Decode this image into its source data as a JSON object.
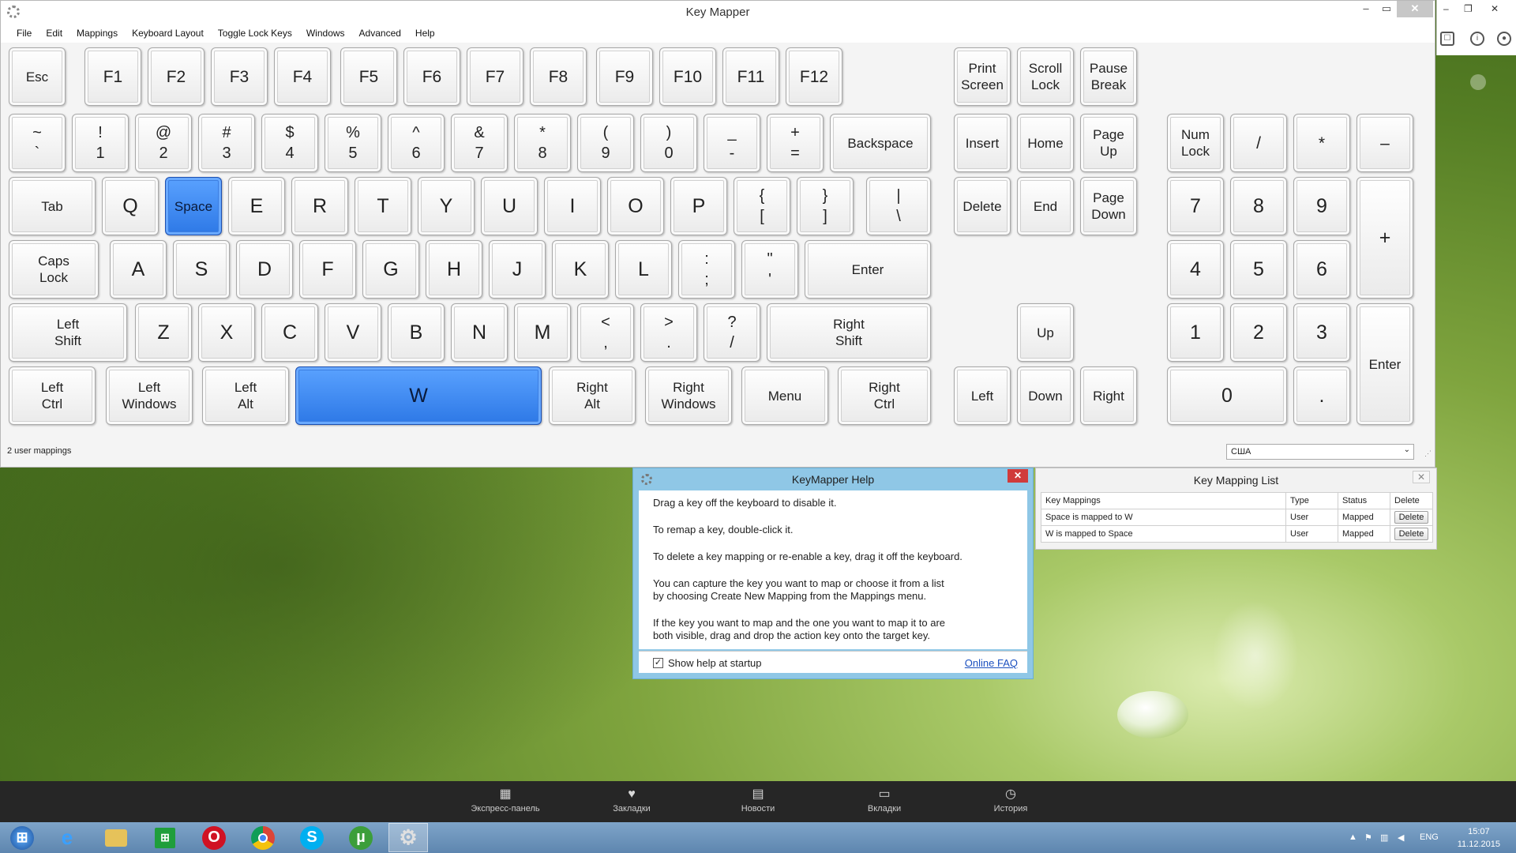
{
  "window": {
    "title": "Key Mapper"
  },
  "menu": [
    "File",
    "Edit",
    "Mappings",
    "Keyboard Layout",
    "Toggle Lock Keys",
    "Windows",
    "Advanced",
    "Help"
  ],
  "keys": {
    "esc": "Esc",
    "f1": "F1",
    "f2": "F2",
    "f3": "F3",
    "f4": "F4",
    "f5": "F5",
    "f6": "F6",
    "f7": "F7",
    "f8": "F8",
    "f9": "F9",
    "f10": "F10",
    "f11": "F11",
    "f12": "F12",
    "prtsc": "Print\nScreen",
    "scroll": "Scroll\nLock",
    "pause": "Pause\nBreak",
    "tilde": "~\n`",
    "k1": "!\n1",
    "k2": "@\n2",
    "k3": "#\n3",
    "k4": "$\n4",
    "k5": "%\n5",
    "k6": "^\n6",
    "k7": "&\n7",
    "k8": "*\n8",
    "k9": "(\n9",
    "k0": ")\n0",
    "minus": "_\n-",
    "equals": "+\n=",
    "backspace": "Backspace",
    "insert": "Insert",
    "home": "Home",
    "pgup": "Page\nUp",
    "numlock": "Num\nLock",
    "npdiv": "/",
    "npmul": "*",
    "npminus": "–",
    "tab": "Tab",
    "q": "Q",
    "w_pos": "Space",
    "e": "E",
    "r": "R",
    "t": "T",
    "y": "Y",
    "u": "U",
    "i": "I",
    "o": "O",
    "p": "P",
    "lbr": "{\n[",
    "rbr": "}\n]",
    "bslash": "|\n\\",
    "delete": "Delete",
    "end": "End",
    "pgdn": "Page\nDown",
    "np7": "7",
    "np8": "8",
    "np9": "9",
    "npplus": "+",
    "caps": "Caps\nLock",
    "a": "A",
    "s": "S",
    "d": "D",
    "f": "F",
    "g": "G",
    "h": "H",
    "j": "J",
    "k": "K",
    "l": "L",
    "semi": ":\n;",
    "quote": "\"\n'",
    "enter": "Enter",
    "np4": "4",
    "np5": "5",
    "np6": "6",
    "lshift": "Left\nShift",
    "z": "Z",
    "x": "X",
    "c": "C",
    "v": "V",
    "b": "B",
    "n": "N",
    "m": "M",
    "comma": "<\n,",
    "period": ">\n.",
    "slash": "?\n/",
    "rshift": "Right\nShift",
    "up": "Up",
    "np1": "1",
    "np2": "2",
    "np3": "3",
    "npenter": "Enter",
    "lctrl": "Left\nCtrl",
    "lwin": "Left\nWindows",
    "lalt": "Left\nAlt",
    "space_pos": "W",
    "ralt": "Right\nAlt",
    "rwin": "Right\nWindows",
    "menu": "Menu",
    "rctrl": "Right\nCtrl",
    "left": "Left",
    "down": "Down",
    "right": "Right",
    "np0": "0",
    "npdot": "."
  },
  "status": {
    "text": "2 user mappings",
    "layout": "США"
  },
  "help": {
    "title": "KeyMapper Help",
    "lines": [
      "Drag a key off the keyboard to disable it.",
      "To remap a key, double-click it.",
      "To delete a key mapping or re-enable a key, drag it off the keyboard.",
      "You can capture the key you want to map or choose it from a list\nby choosing Create New Mapping from the Mappings menu.",
      "If the key you want to map and the one you want to map it to are\nboth visible, drag and drop the action key onto the target key."
    ],
    "checkbox_label": "Show help at startup",
    "checkbox_mark": "✓",
    "faq": "Online FAQ"
  },
  "mapping_list": {
    "title": "Key Mapping List",
    "headers": [
      "Key Mappings",
      "Type",
      "Status",
      "Delete"
    ],
    "rows": [
      {
        "mapping": "Space is mapped to W",
        "type": "User",
        "status": "Mapped",
        "delete": "Delete"
      },
      {
        "mapping": "W is mapped to Space",
        "type": "User",
        "status": "Mapped",
        "delete": "Delete"
      }
    ]
  },
  "speedbar": [
    {
      "label": "Экспресс-панель",
      "icon": "grid-icon"
    },
    {
      "label": "Закладки",
      "icon": "heart-icon"
    },
    {
      "label": "Новости",
      "icon": "news-icon"
    },
    {
      "label": "Вкладки",
      "icon": "tabs-icon"
    },
    {
      "label": "История",
      "icon": "clock-icon"
    }
  ],
  "tray": {
    "lang": "ENG",
    "time": "15:07",
    "date": "11.12.2015"
  },
  "colors": {
    "mapped": "#2d78e6",
    "taskbar": "#6f95bd",
    "speedbar": "#262626"
  }
}
